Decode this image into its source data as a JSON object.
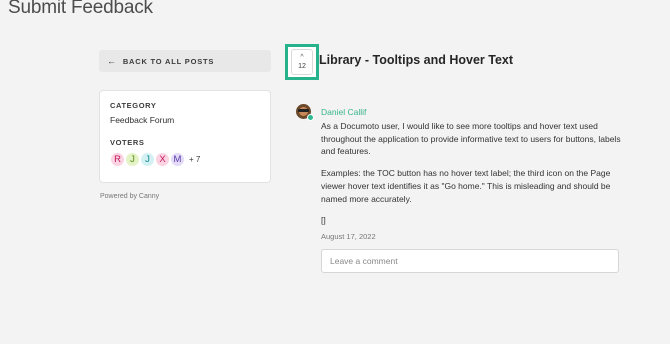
{
  "page": {
    "title": "Submit Feedback"
  },
  "sidebar": {
    "back_label": "BACK TO ALL POSTS",
    "back_icon": "arrow-left-icon",
    "category_label": "CATEGORY",
    "category_value": "Feedback Forum",
    "voters_label": "VOTERS",
    "voters": [
      {
        "initial": "R",
        "bg": "#fbd3e2",
        "color": "#c2185b"
      },
      {
        "initial": "J",
        "bg": "#e4f3c6",
        "color": "#5a8a1a"
      },
      {
        "initial": "J",
        "bg": "#d3f1f3",
        "color": "#1a8a93"
      },
      {
        "initial": "X",
        "bg": "#fbd3e2",
        "color": "#c2185b"
      },
      {
        "initial": "M",
        "bg": "#e3dbf7",
        "color": "#5b3aa8"
      }
    ],
    "voters_more": "+ 7",
    "powered_by": "Powered by Canny"
  },
  "post": {
    "vote_count": "12",
    "vote_icon": "chevron-up-icon",
    "title": "Library - Tooltips and Hover Text",
    "author": "Daniel Callif",
    "body": [
      "As a Documoto user, I would like to see more tooltips and hover text used throughout the application to provide informative text to users for buttons, labels and features.",
      "Examples: the TOC button has no hover text label; the third icon on the Page viewer hover text identifies it as \"Go home.\" This is misleading and should be named more accurately.",
      "[]"
    ],
    "date": "August 17, 2022",
    "comment_placeholder": "Leave a comment"
  },
  "colors": {
    "accent": "#26b38c",
    "author": "#38b48e"
  }
}
